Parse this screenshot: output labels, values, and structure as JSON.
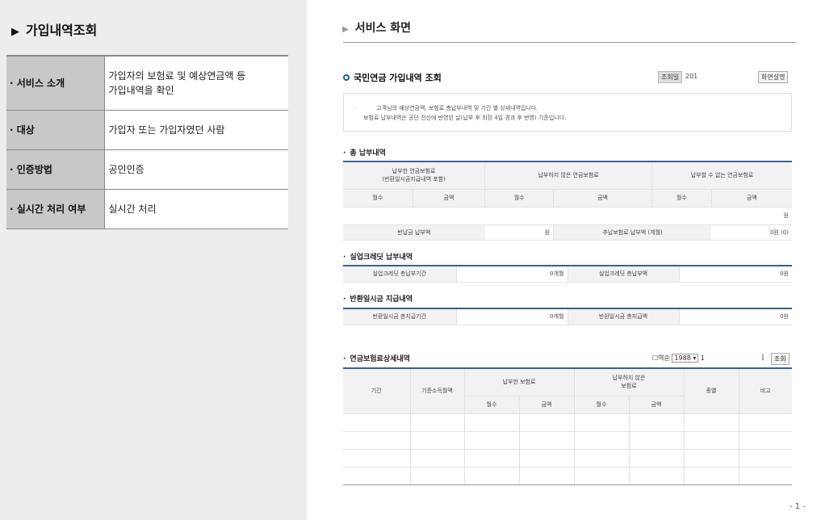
{
  "left": {
    "title": "가입내역조회",
    "rows": [
      {
        "label": "· 서비스 소개",
        "value_line1": "가입자의 보험료 및 예상연금액 등",
        "value_line2": "가입내역을 확인"
      },
      {
        "label": "· 대상",
        "value_line1": "가입자 또는 가입자였던 사람",
        "value_line2": ""
      },
      {
        "label": "· 인증방법",
        "value_line1": "공인인증",
        "value_line2": ""
      },
      {
        "label": "· 실시간 처리 여부",
        "value_line1": "실시간 처리",
        "value_line2": ""
      }
    ]
  },
  "right": {
    "title": "서비스 화면",
    "doc_title": "국민연금 가입내역 조회",
    "query_date_label": "조회일",
    "query_date_value": "201",
    "help_button": "화면설명",
    "notice_line1": "고객님의 예상연금액, 보험료 총납부내역 및 기간 별 상세내역입니다.",
    "notice_line2": "보험료 납부내역은 공단 전산에 반영된 날(납부 후 최장 4일 경과 후 반영) 기준입니다.",
    "section1": {
      "title": "총 납부내역",
      "h_paid_1": "납부한 연금보험료",
      "h_paid_2": "(반환일시금지급내역 포함)",
      "h_unpaid": "납부하지 않은 연금보험료",
      "h_unpayable": "납부할 수 없는 연금보험료",
      "months": "월수",
      "amount": "금액",
      "unit_won": "원",
      "refund_label": "반납금 납부액",
      "refund_value": "원",
      "makeup_label": "추납보험료 납부액 (개월)",
      "makeup_value": "0원 (0)"
    },
    "section2": {
      "title": "실업크레딧 납부내역",
      "period_label": "실업크레딧 총납부기간",
      "period_value": "0개월",
      "amount_label": "실업크레딧 총납부액",
      "amount_value": "0원"
    },
    "section3": {
      "title": "반환일시금 지급내역",
      "period_label": "반환일시금 총지급기간",
      "period_value": "0개월",
      "amount_label": "반환일시금 총지급액",
      "amount_value": "0원"
    },
    "section4": {
      "title": "연금보험료상세내역",
      "checkbox_label": "역순",
      "year_select": "1988",
      "month_value": "1",
      "bracket": "]",
      "search_button": "조회",
      "h_period": "기간",
      "h_income": "기준소득월액",
      "h_paid": "납부한 보험료",
      "h_unpaid_1": "납부하지 않은",
      "h_unpaid_2": "보험료",
      "h_type": "종별",
      "h_note": "비고",
      "months": "월수",
      "amount": "금액"
    },
    "page_number": "- 1 -"
  }
}
